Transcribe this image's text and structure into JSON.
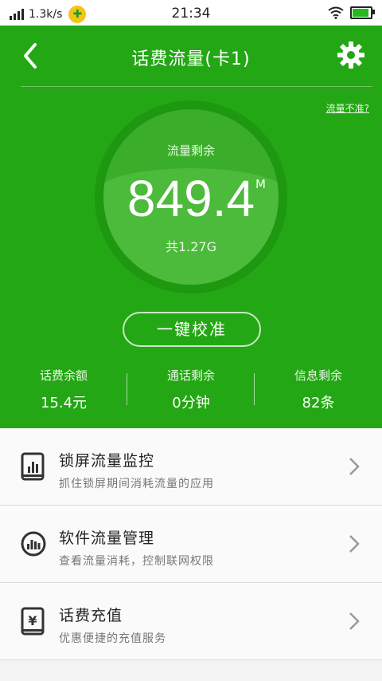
{
  "status_bar": {
    "speed": "1.3k/s",
    "time": "21:34",
    "battery_level": 0.85
  },
  "header": {
    "title": "话费流量(卡1)",
    "back_icon": "back-arrow-icon",
    "settings_icon": "gear-icon"
  },
  "inaccurate_link": "流量不准?",
  "data_usage": {
    "label": "流量剩余",
    "value": "849.4",
    "unit": "M",
    "total": "共1.27G"
  },
  "calibrate_button": "一键校准",
  "stats": [
    {
      "label": "话费余额",
      "value": "15.4元"
    },
    {
      "label": "通话剩余",
      "value": "0分钟"
    },
    {
      "label": "信息剩余",
      "value": "82条"
    }
  ],
  "menu": [
    {
      "title": "锁屏流量监控",
      "subtitle": "抓住锁屏期间消耗流量的应用",
      "icon": "phone-chart-icon"
    },
    {
      "title": "软件流量管理",
      "subtitle": "查看流量消耗，控制联网权限",
      "icon": "circle-chart-icon"
    },
    {
      "title": "话费充值",
      "subtitle": "优惠便捷的充值服务",
      "icon": "phone-yuan-icon"
    }
  ],
  "colors": {
    "primary_green": "#23a714",
    "list_bg": "#fafafa"
  }
}
